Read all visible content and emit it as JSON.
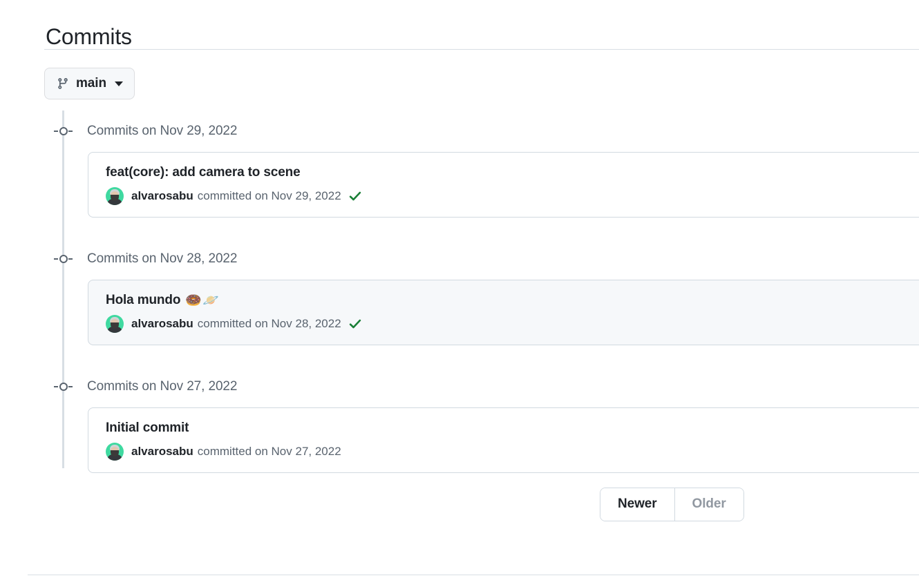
{
  "header": {
    "title": "Commits"
  },
  "branch_selector": {
    "icon": "git-branch-icon",
    "label": "main",
    "caret_icon": "chevron-down-icon"
  },
  "commit_groups": [
    {
      "date_heading": "Commits on Nov 29, 2022",
      "commits": [
        {
          "message": "feat(core): add camera to scene",
          "emoji": "",
          "author": "alvarosabu",
          "committed_text": "committed on Nov 29, 2022",
          "verified": true,
          "verified_icon": "check-icon",
          "highlighted": false
        }
      ]
    },
    {
      "date_heading": "Commits on Nov 28, 2022",
      "commits": [
        {
          "message": "Hola mundo",
          "emoji": "🍩🪐",
          "author": "alvarosabu",
          "committed_text": "committed on Nov 28, 2022",
          "verified": true,
          "verified_icon": "check-icon",
          "highlighted": true
        }
      ]
    },
    {
      "date_heading": "Commits on Nov 27, 2022",
      "commits": [
        {
          "message": "Initial commit",
          "emoji": "",
          "author": "alvarosabu",
          "committed_text": "committed on Nov 27, 2022",
          "verified": false,
          "verified_icon": "",
          "highlighted": false
        }
      ]
    }
  ],
  "pagination": {
    "newer_label": "Newer",
    "older_label": "Older",
    "newer_enabled": true,
    "older_enabled": false
  },
  "colors": {
    "text_primary": "#1f2328",
    "text_muted": "#59636e",
    "text_disabled": "#9198a1",
    "border": "#d1d9e0",
    "divider": "#d8dee4",
    "surface_subtle": "#f6f8fa",
    "verified_green": "#1a7f37",
    "avatar_background": "#3fd9a0"
  }
}
